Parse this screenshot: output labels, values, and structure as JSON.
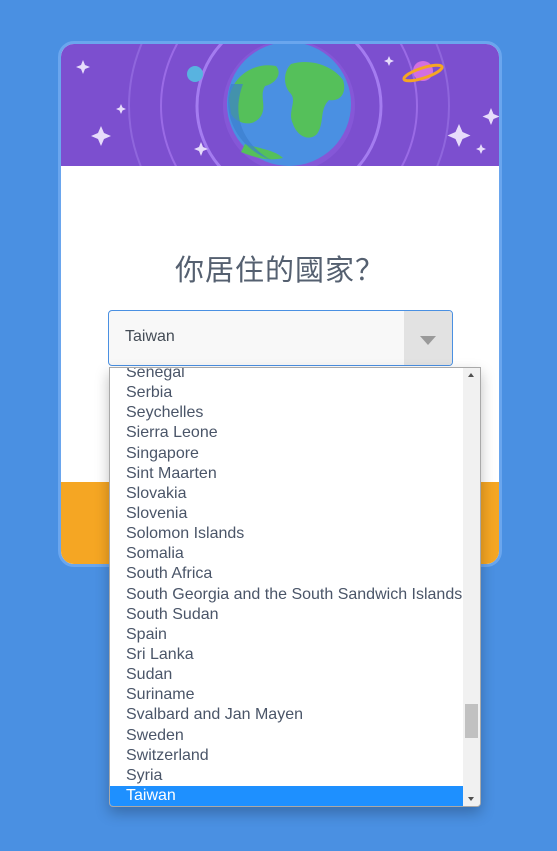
{
  "question": {
    "title": "你居住的國家？"
  },
  "country_select": {
    "selected_value": "Taiwan"
  },
  "dropdown": {
    "options": [
      "Senegal",
      "Serbia",
      "Seychelles",
      "Sierra Leone",
      "Singapore",
      "Sint Maarten",
      "Slovakia",
      "Slovenia",
      "Solomon Islands",
      "Somalia",
      "South Africa",
      "South Georgia and the South Sandwich Islands",
      "South Sudan",
      "Spain",
      "Sri Lanka",
      "Sudan",
      "Suriname",
      "Svalbard and Jan Mayen",
      "Sweden",
      "Switzerland",
      "Syria",
      "Taiwan"
    ],
    "selected_option": "Taiwan",
    "scroll_position": 0.85
  },
  "colors": {
    "page_background": "#4a90e2",
    "banner": "#7c4fcf",
    "accent_orange": "#f5a623",
    "selected_highlight": "#1e90ff"
  },
  "icons": {
    "banner": "earth-space-illustration",
    "select_arrow": "caret-down-icon"
  }
}
